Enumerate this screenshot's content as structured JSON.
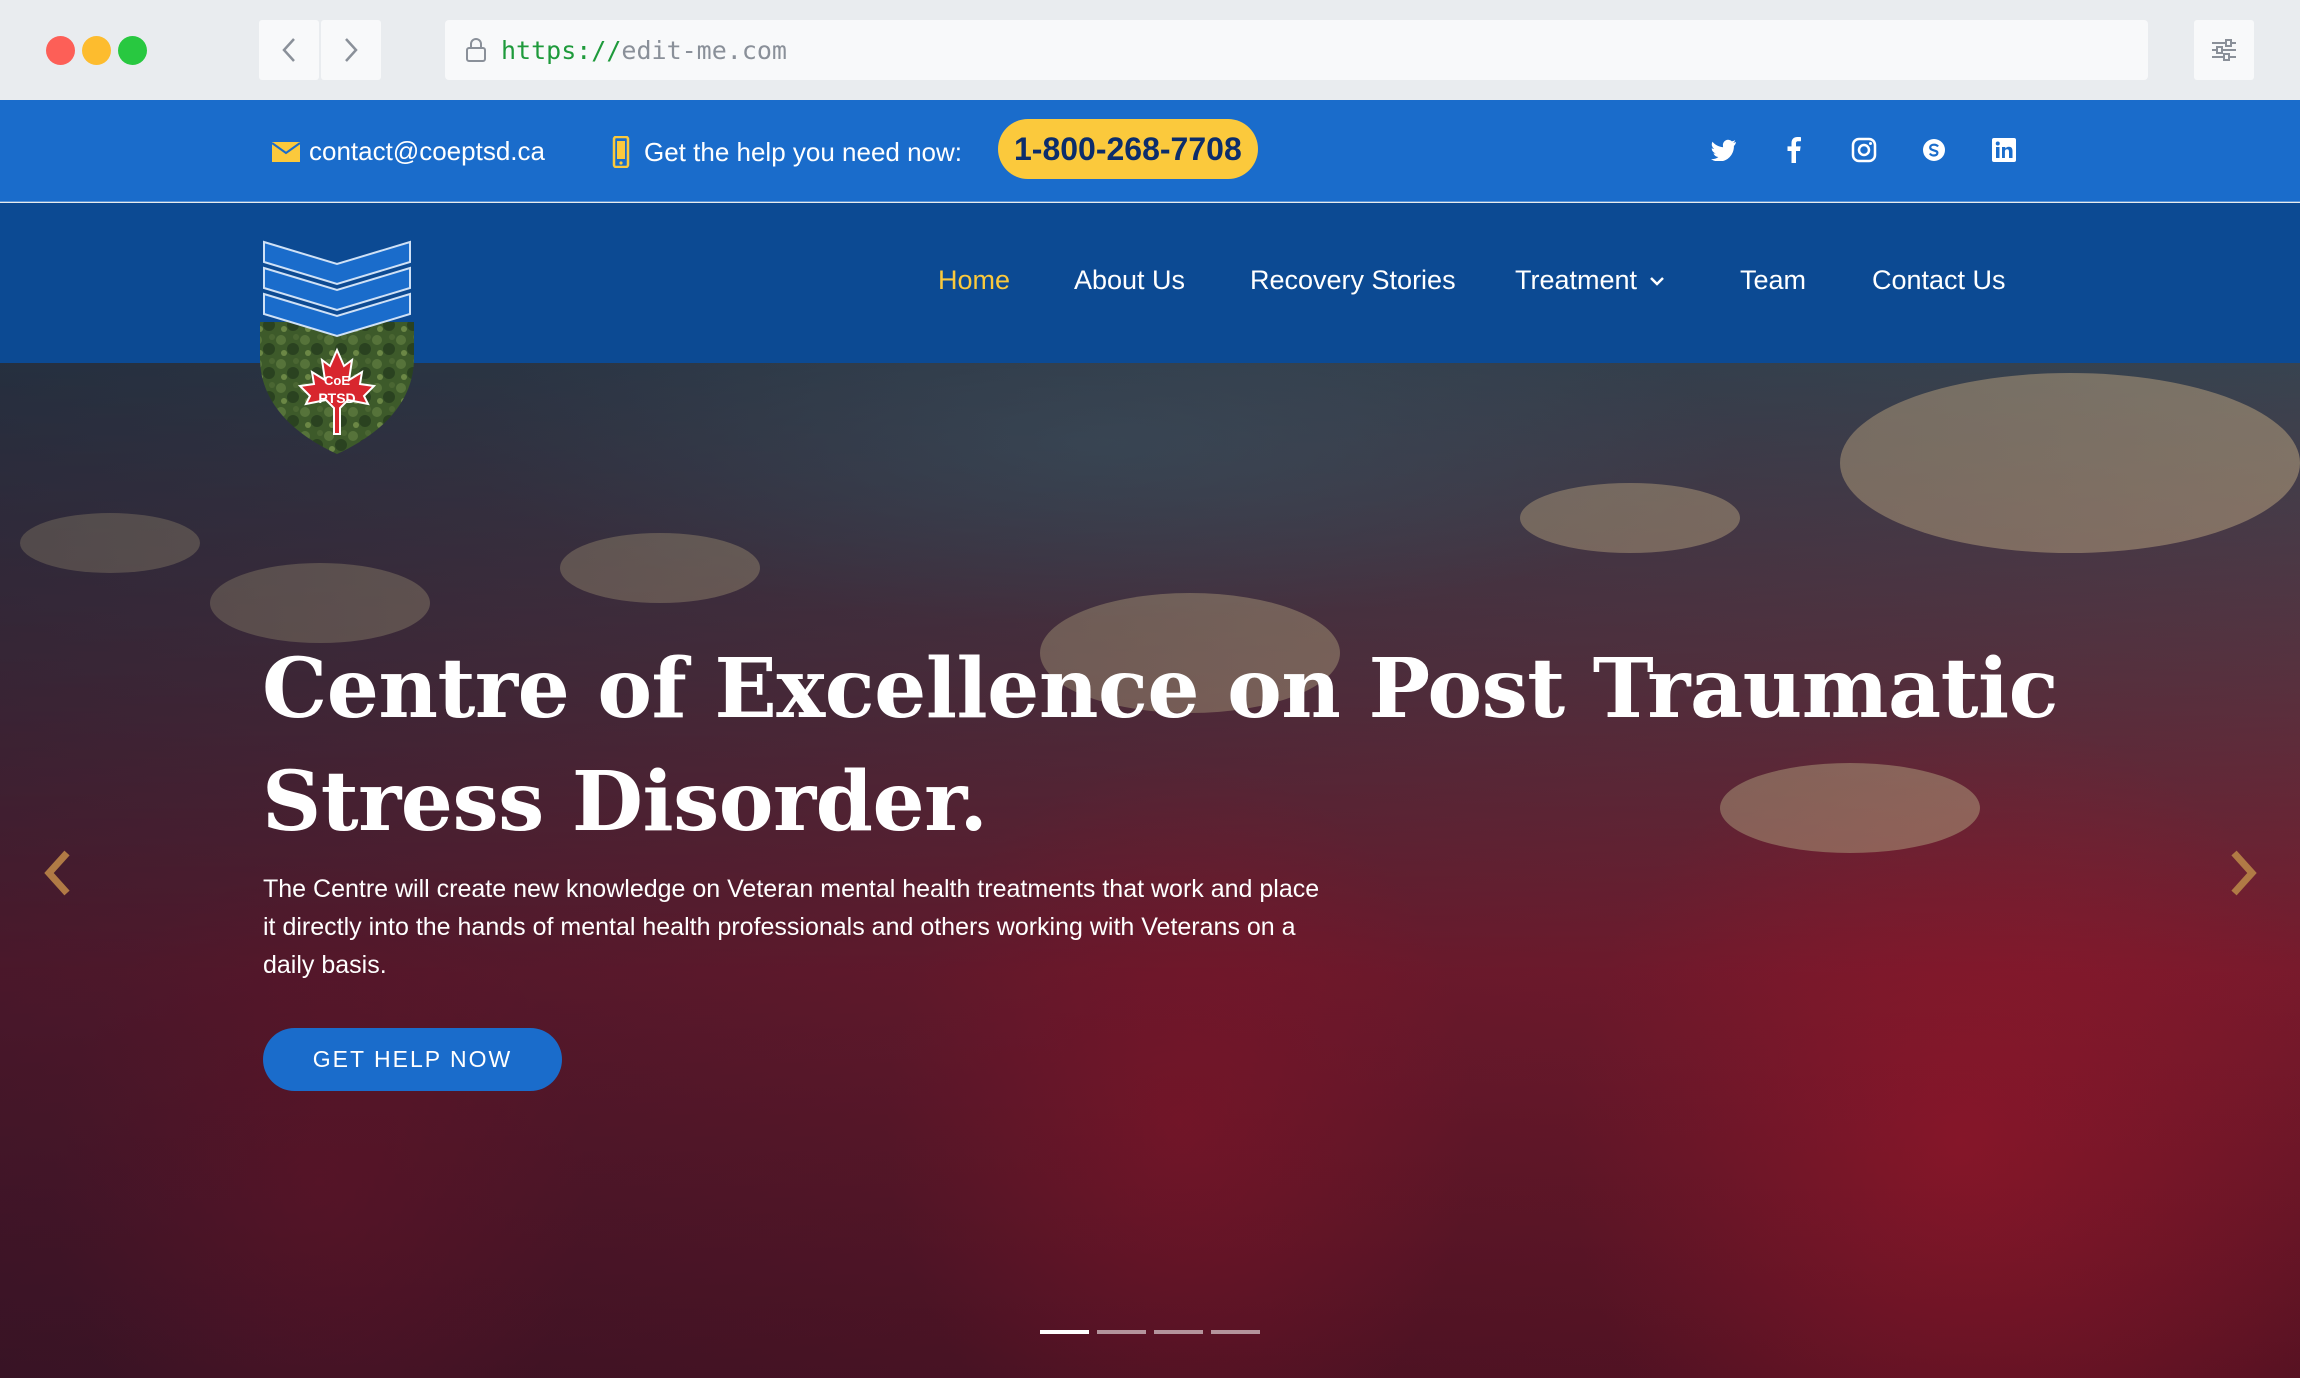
{
  "browser": {
    "url_scheme": "https://",
    "url_host": "edit-me.com",
    "icons": [
      "back-icon",
      "forward-icon",
      "lock-icon",
      "settings-sliders-icon"
    ]
  },
  "topbar": {
    "email": "contact@coeptsd.ca",
    "help_text": "Get the help you need now:",
    "phone": "1-800-268-7708",
    "social_icons": [
      "twitter-icon",
      "facebook-icon",
      "instagram-icon",
      "skype-icon",
      "linkedin-icon"
    ]
  },
  "logo": {
    "line1": "CoE",
    "line2": "PTSD"
  },
  "nav": {
    "items": [
      {
        "label": "Home",
        "active": true
      },
      {
        "label": "About Us"
      },
      {
        "label": "Recovery Stories"
      },
      {
        "label": "Treatment",
        "has_dropdown": true
      },
      {
        "label": "Team"
      },
      {
        "label": "Contact Us"
      }
    ]
  },
  "hero": {
    "title": "Centre of Excellence on Post Traumatic Stress Disorder.",
    "description": "The Centre will create new knowledge on Veteran mental health treatments that work and place it directly into the hands of mental health professionals and others working with Veterans on a daily basis.",
    "cta": "GET HELP NOW",
    "slides_total": 4,
    "active_slide": 1
  },
  "colors": {
    "topbar_bg": "#1a6ccb",
    "nav_bg": "#0c4a93",
    "accent_yellow": "#fbc93c",
    "cta_bg": "#1a6ccb"
  }
}
